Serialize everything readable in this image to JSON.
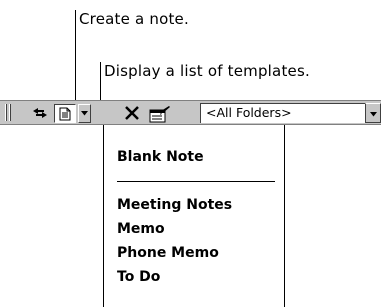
{
  "callouts": {
    "create_note": "Create a note.",
    "templates_list": "Display a list of templates."
  },
  "toolbar": {
    "buttons": [
      {
        "name": "move-copy",
        "icon": "arrows-icon"
      },
      {
        "name": "new-note",
        "icon": "note-icon"
      },
      {
        "name": "templates-dropdown",
        "icon": "triangle-down-icon"
      },
      {
        "name": "delete",
        "icon": "x-icon"
      },
      {
        "name": "properties",
        "icon": "properties-icon"
      }
    ],
    "folder_select": {
      "value": "<All Folders>",
      "icon": "triangle-down-icon"
    }
  },
  "templates_menu": {
    "items": [
      {
        "label": "Blank Note"
      },
      {
        "label": "Meeting Notes"
      },
      {
        "label": "Memo"
      },
      {
        "label": "Phone Memo"
      },
      {
        "label": "To Do"
      }
    ]
  }
}
